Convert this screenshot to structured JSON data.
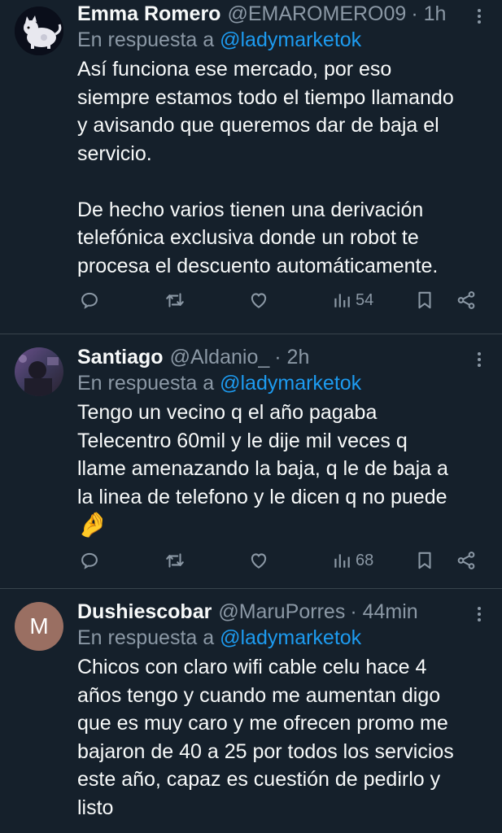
{
  "reply_prefix": "En respuesta a",
  "tweets": [
    {
      "name": "Emma Romero",
      "handle": "@EMAROMERO09",
      "time": "· 1h",
      "reply_to": "@ladymarketok",
      "text": "Así funciona ese mercado, por eso\nsiempre estamos todo el tiempo llamando\ny avisando que queremos dar de baja el\nservicio.\n\nDe hecho varios tienen una derivación\ntelefónica exclusiva donde un robot te\nprocesa el descuento automáticamente.",
      "views": "54",
      "avatar": "cat-illustration"
    },
    {
      "name": "Santiago",
      "handle": "@Aldanio_",
      "time": "· 2h",
      "reply_to": "@ladymarketok",
      "text": "Tengo un vecino q el año pagaba\nTelecentro 60mil y le dije mil veces q\nllame amenazando la baja, q le de baja a\nla linea de telefono y le dicen q no puede",
      "emoji": "🤌",
      "views": "68",
      "avatar": "photo"
    },
    {
      "name": "Dushiescobar",
      "handle": "@MaruPorres",
      "time": "· 44min",
      "reply_to": "@ladymarketok",
      "text": "Chicos con claro wifi cable celu hace 4\naños tengo y cuando me aumentan digo\nque es muy caro y me ofrecen promo me\nbajaron de 40 a 25 por todos los servicios\neste año, capaz es cuestión de pedirlo y\nlisto",
      "avatar_letter": "M",
      "avatar": "letter"
    }
  ],
  "colors": {
    "background": "#15202b",
    "text": "#f7f9f9",
    "secondary": "#8b98a5",
    "accent": "#1d9bf0",
    "divider": "#38444d",
    "avatar_letter_bg": "#9a6f62"
  }
}
